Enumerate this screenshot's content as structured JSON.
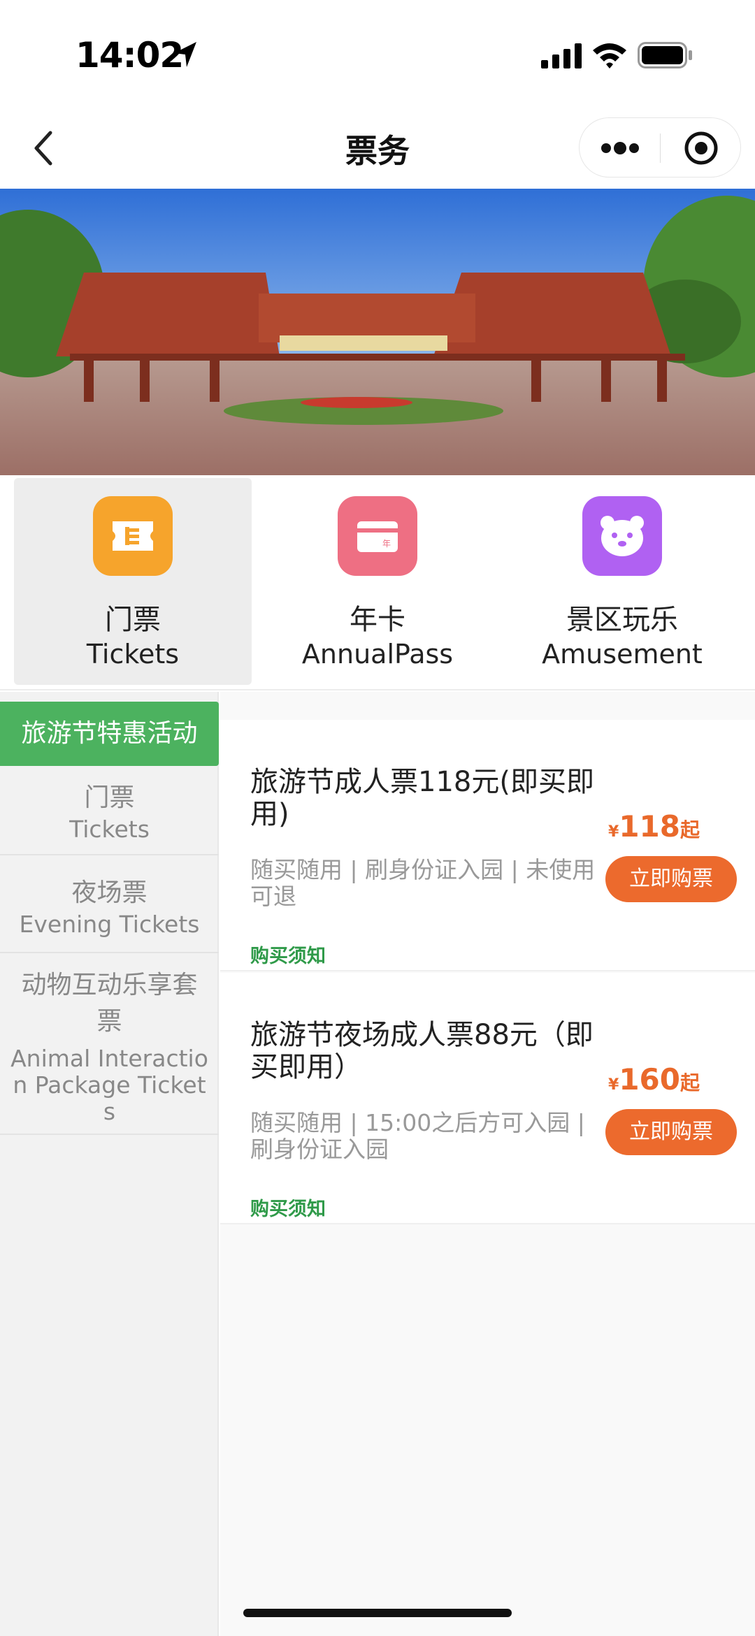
{
  "status_bar": {
    "time": "14:02"
  },
  "nav": {
    "title": "票务"
  },
  "categories": [
    {
      "zh": "门票",
      "en": "Tickets",
      "color": "#f6a42c"
    },
    {
      "zh": "年卡",
      "en": "AnnualPass",
      "color": "#ee6f83"
    },
    {
      "zh": "景区玩乐",
      "en": "Amusement",
      "color": "#b061f2"
    }
  ],
  "side_menu": {
    "active": "旅游节特惠活动",
    "items": [
      {
        "zh": "门票",
        "en": "Tickets"
      },
      {
        "zh": "夜场票",
        "en": "Evening Tickets"
      },
      {
        "zh": "动物互动乐享套票",
        "en": "Animal Interaction Package Tickets"
      }
    ]
  },
  "tickets": [
    {
      "title": "旅游节成人票118元(即买即用)",
      "desc": "随买随用 | 刷身份证入园 | 未使用可退",
      "notice": "购买须知",
      "price_symbol": "¥",
      "price": "118",
      "price_suffix": "起",
      "button": "立即购票"
    },
    {
      "title": "旅游节夜场成人票88元（即买即用）",
      "desc": "随买随用 | 15:00之后方可入园 | 刷身份证入园",
      "notice": "购买须知",
      "price_symbol": "¥",
      "price": "160",
      "price_suffix": "起",
      "button": "立即购票"
    }
  ],
  "colors": {
    "accent_green": "#4cb25f",
    "price_orange": "#e9692b",
    "button_orange": "#ec6a2d"
  }
}
